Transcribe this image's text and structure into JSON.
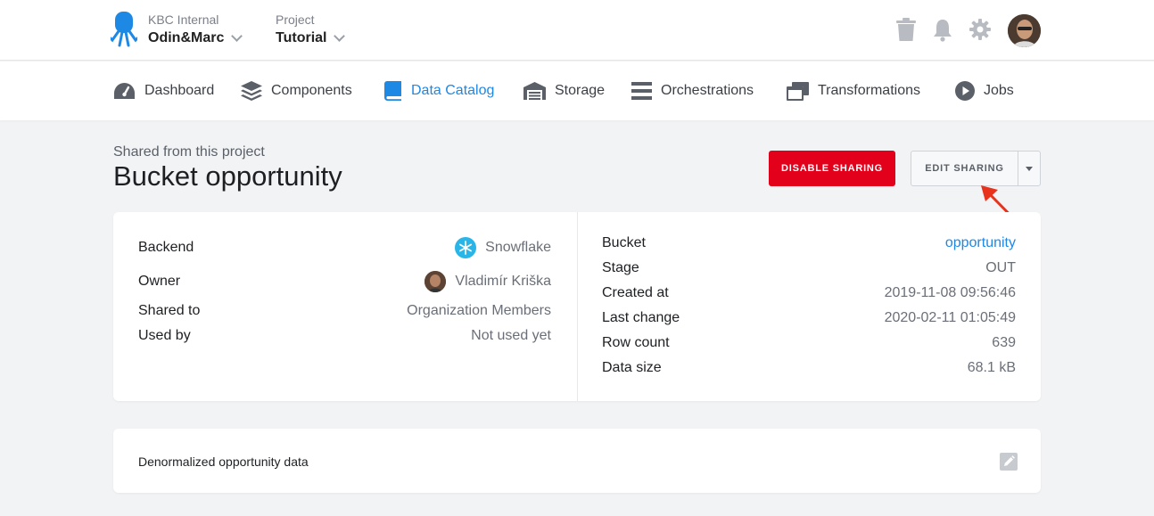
{
  "topbar": {
    "org_label": "KBC Internal",
    "org_name": "Odin&Marc",
    "project_label": "Project",
    "project_name": "Tutorial"
  },
  "nav": {
    "items": [
      {
        "label": "Dashboard",
        "icon": "dashboard-icon"
      },
      {
        "label": "Components",
        "icon": "layers-icon"
      },
      {
        "label": "Data Catalog",
        "icon": "book-icon",
        "active": true
      },
      {
        "label": "Storage",
        "icon": "warehouse-icon"
      },
      {
        "label": "Orchestrations",
        "icon": "bars-icon"
      },
      {
        "label": "Transformations",
        "icon": "windows-icon"
      },
      {
        "label": "Jobs",
        "icon": "play-circle-icon"
      }
    ]
  },
  "header": {
    "subtitle": "Shared from this project",
    "title": "Bucket opportunity",
    "disable_label": "DISABLE SHARING",
    "edit_label": "EDIT SHARING"
  },
  "info_left": [
    {
      "key": "Backend",
      "value": "Snowflake"
    },
    {
      "key": "Owner",
      "value": "Vladimír Kriška"
    },
    {
      "key": "Shared to",
      "value": "Organization Members"
    },
    {
      "key": "Used by",
      "value": "Not used yet"
    }
  ],
  "info_right": [
    {
      "key": "Bucket",
      "value": "opportunity"
    },
    {
      "key": "Stage",
      "value": "OUT"
    },
    {
      "key": "Created at",
      "value": "2019-11-08 09:56:46"
    },
    {
      "key": "Last change",
      "value": "2020-02-11 01:05:49"
    },
    {
      "key": "Row count",
      "value": "639"
    },
    {
      "key": "Data size",
      "value": "68.1 kB"
    }
  ],
  "description": {
    "text": "Denormalized opportunity data"
  },
  "colors": {
    "accent": "#1e88e5",
    "danger": "#e3001b",
    "arrow": "#e8321b"
  }
}
